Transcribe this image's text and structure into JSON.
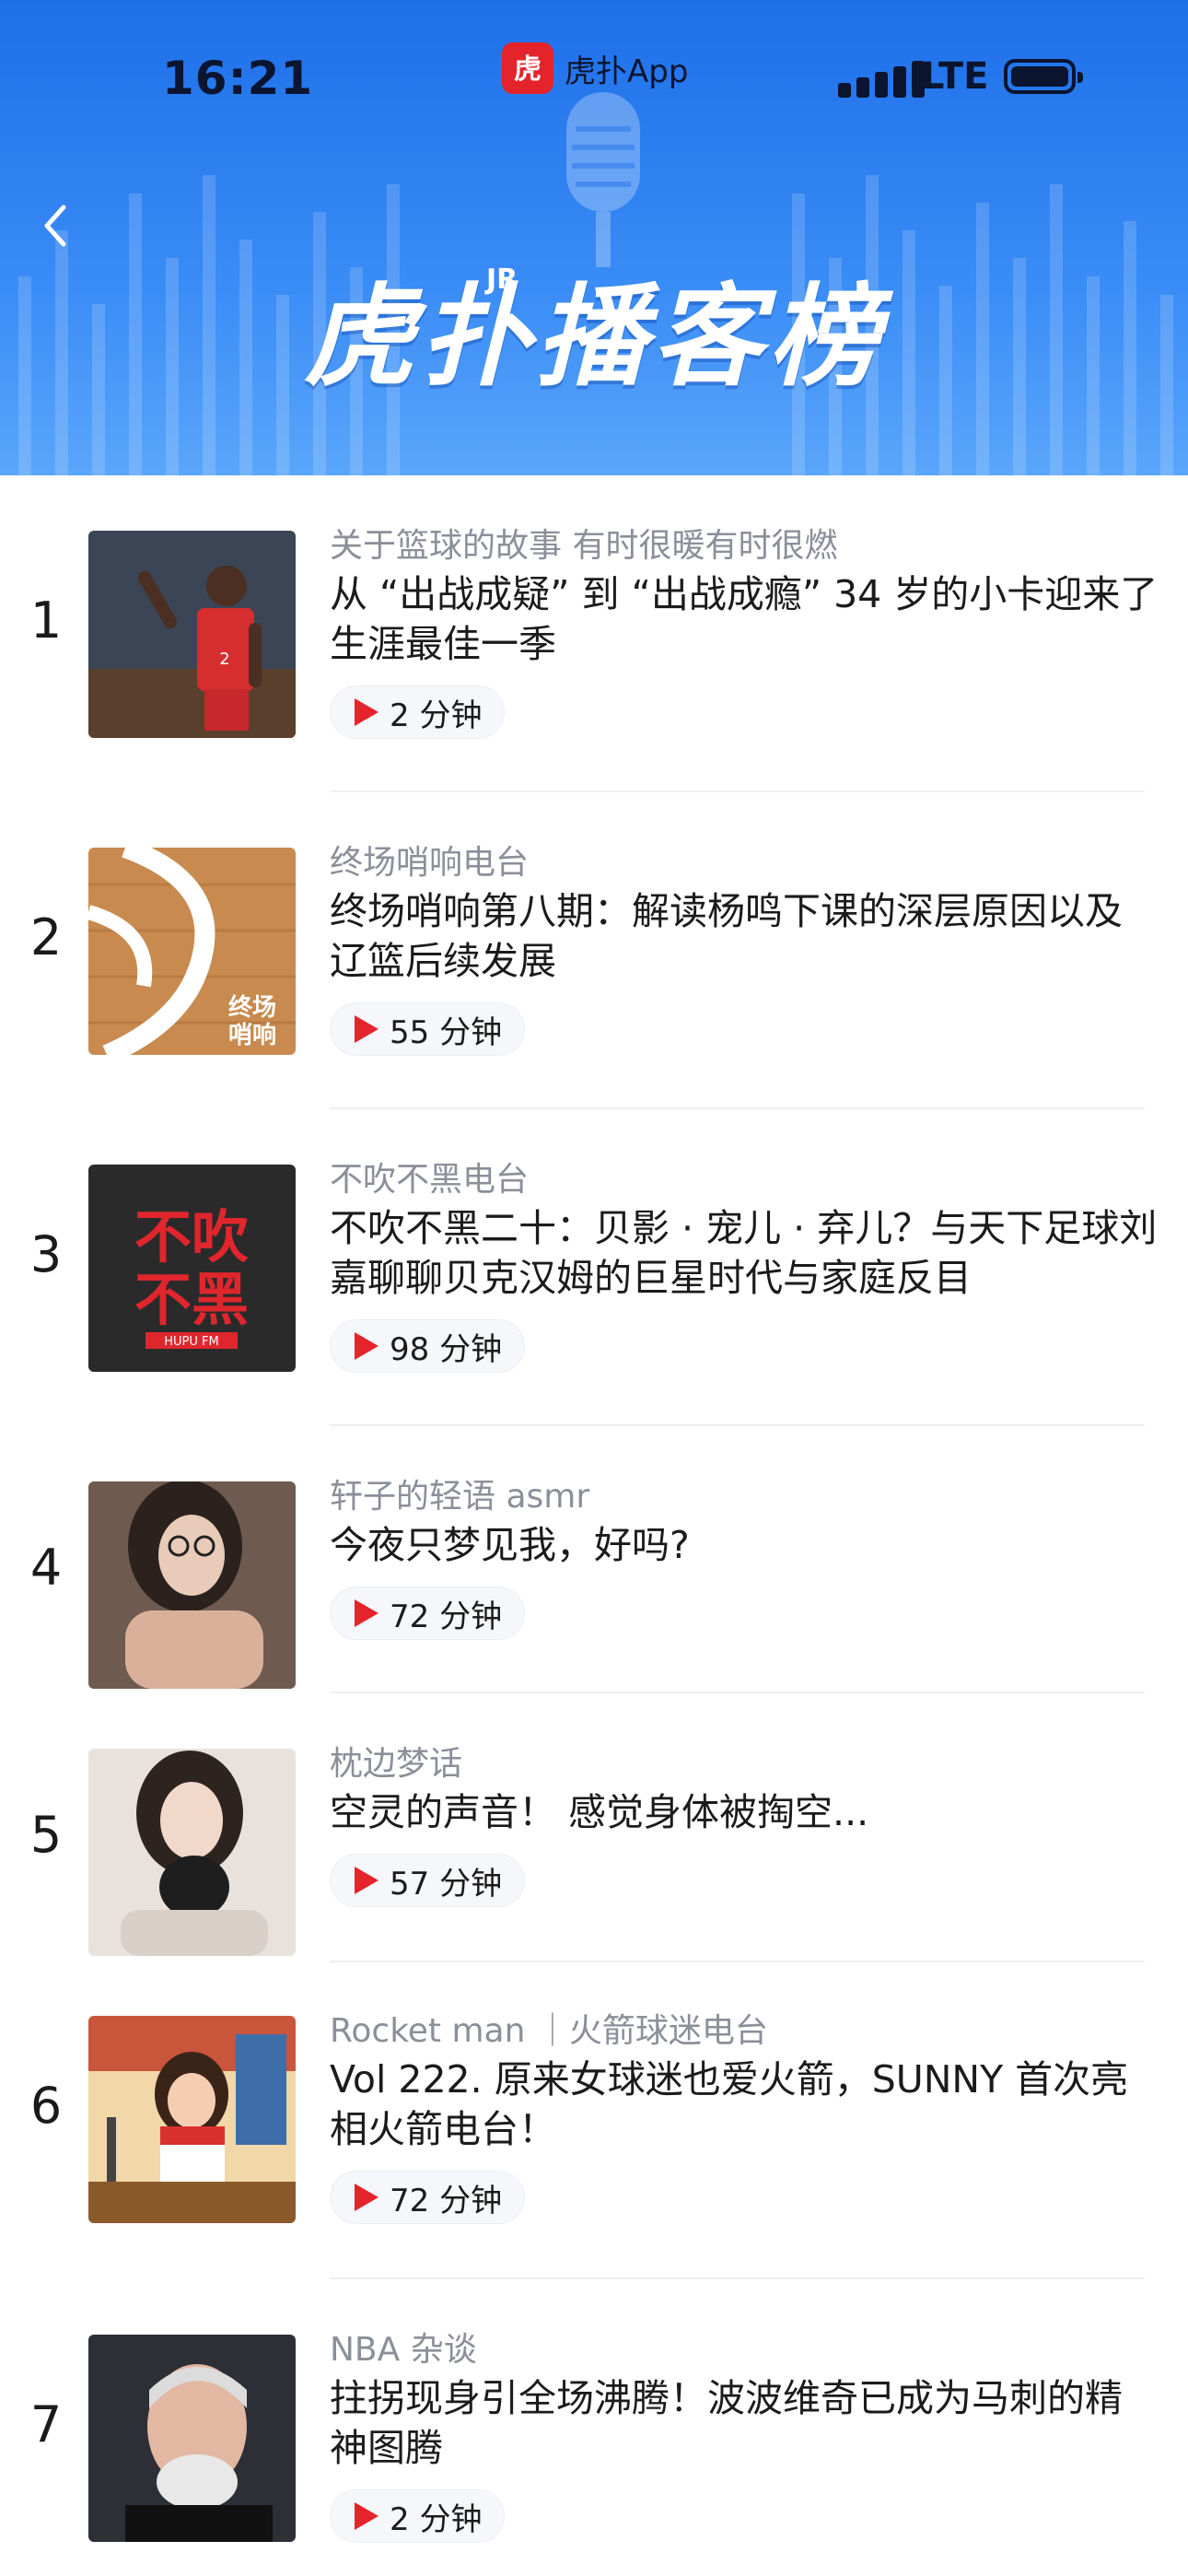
{
  "status_bar": {
    "time": "16:21",
    "app_name": "虎扑App",
    "app_logo_text": "虎扑",
    "network": "LTE"
  },
  "banner": {
    "title": "虎扑播客榜",
    "mark": "JR"
  },
  "colors": {
    "header_blue": "#2f80f0",
    "accent_red": "#e5232b",
    "secondary_text": "#8a8f99"
  },
  "icons": {
    "back": "chevron-left-icon",
    "play": "play-icon",
    "mic": "microphone-icon"
  },
  "episodes": [
    {
      "rank": "1",
      "channel": "关于篮球的故事 有时很暖有时很燃",
      "title": "从 “出战成疑” 到 “出战成瘾” 34 岁的小卡迎来了生涯最佳一季",
      "duration": "2 分钟"
    },
    {
      "rank": "2",
      "channel": "终场哨响电台",
      "title": "终场哨响第八期：解读杨鸣下课的深层原因以及辽篮后续发展",
      "duration": "55 分钟",
      "cover_text": "终场 哨响"
    },
    {
      "rank": "3",
      "channel": "不吹不黑电台",
      "title": "不吹不黑二十：贝影 · 宠儿 · 弃儿？与天下足球刘嘉聊聊贝克汉姆的巨星时代与家庭反目",
      "duration": "98 分钟",
      "cover_text": "不吹 不黑"
    },
    {
      "rank": "4",
      "channel": "轩子的轻语 asmr",
      "title": "今夜只梦见我，好吗?",
      "duration": "72 分钟"
    },
    {
      "rank": "5",
      "channel": "枕边梦话",
      "title": "空灵的声音！ 感觉身体被掏空...",
      "duration": "57 分钟"
    },
    {
      "rank": "6",
      "channel": "Rocket man ｜火箭球迷电台",
      "title": "Vol 222. 原来女球迷也爱火箭，SUNNY 首次亮相火箭电台！",
      "duration": "72 分钟"
    },
    {
      "rank": "7",
      "channel": "NBA 杂谈",
      "title": "拄拐现身引全场沸腾！波波维奇已成为马刺的精神图腾",
      "duration": "2 分钟"
    }
  ]
}
